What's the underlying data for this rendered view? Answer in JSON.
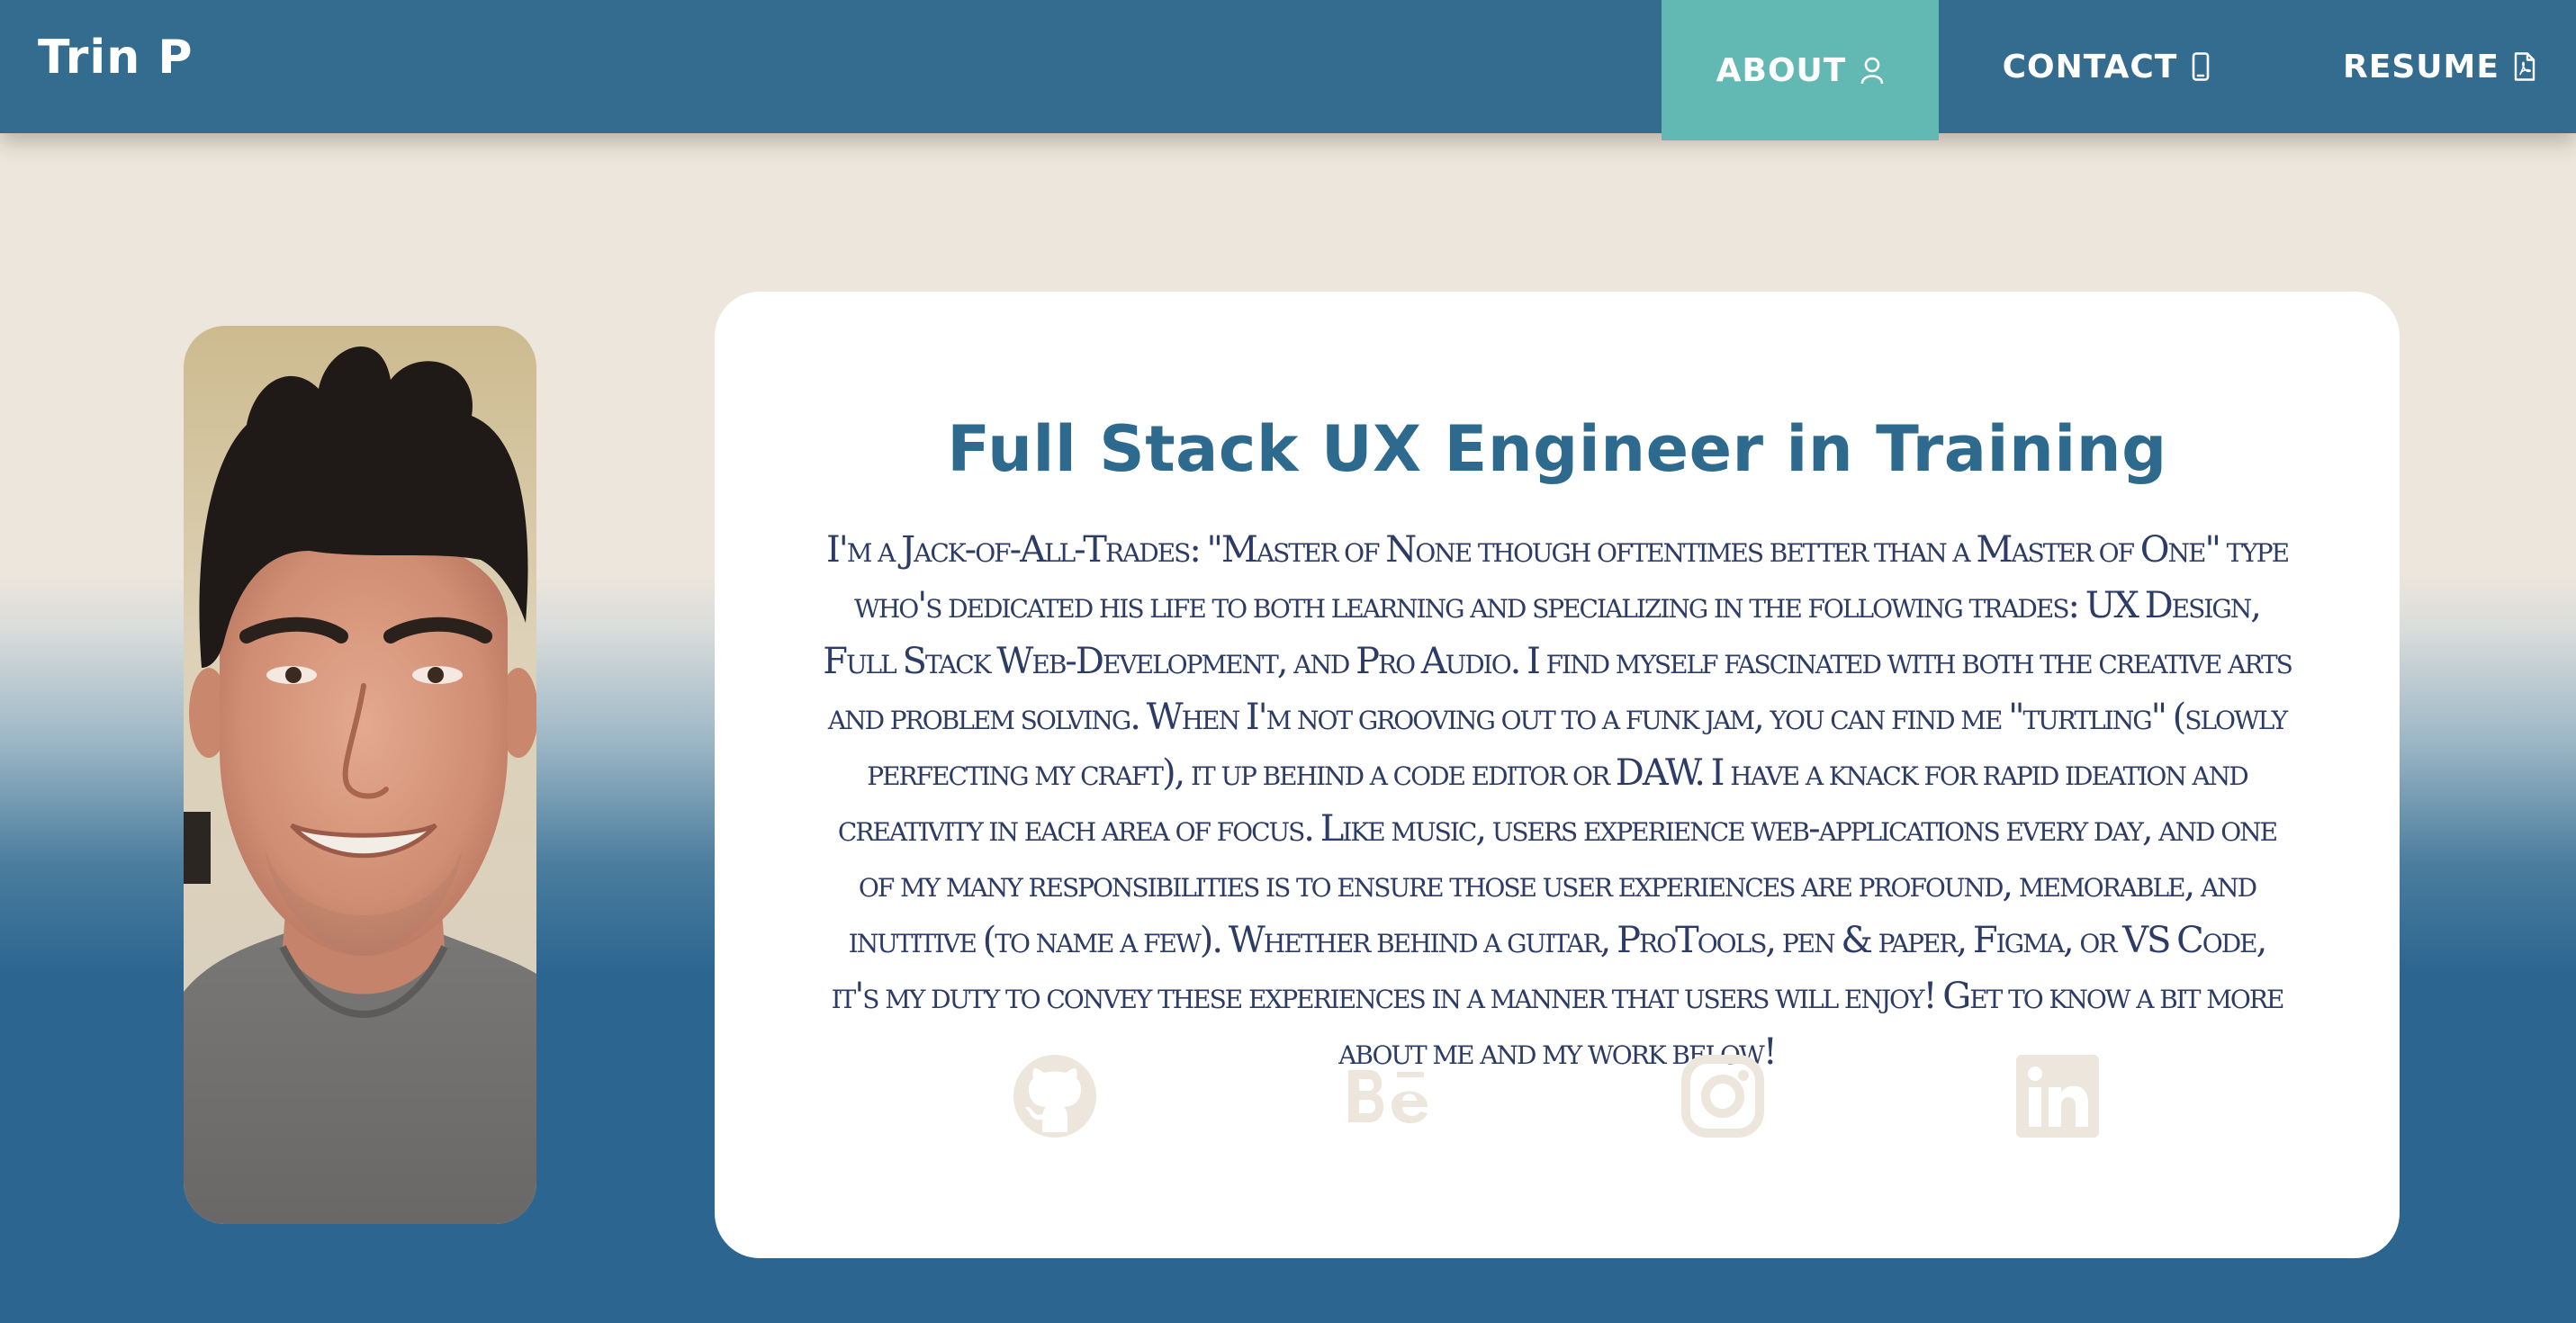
{
  "header": {
    "brand": "Trin P",
    "nav": [
      {
        "label": "ABOUT",
        "icon": "user-icon",
        "active": true
      },
      {
        "label": "CONTACT",
        "icon": "phone-icon",
        "active": false
      },
      {
        "label": "RESUME",
        "icon": "pdf-file-icon",
        "active": false
      }
    ]
  },
  "photo": {
    "alt": "Portrait of Trin P"
  },
  "card": {
    "title": "Full Stack UX Engineer in Training",
    "bio": "I'm a Jack-of-All-Trades: \"Master of None though oftentimes better than a Master of One\" type who's dedicated his life to both learning and specializing in the following trades: UX Design, Full Stack Web-Development, and Pro Audio. I find myself fascinated with both the creative arts and problem solving. When I'm not grooving out to a funk jam, you can find me \"turtling\" (slowly perfecting my craft), it up behind a code editor or DAW. I have a knack for rapid ideation and creativity in each area of focus. Like music, users experience web-applications every day, and one of my many responsibilities is to ensure those user experiences are profound, memorable, and inutitive (to name a few). Whether behind a guitar, ProTools, pen & paper, Figma, or VS Code, it's my duty to convey these experiences in a manner that users will enjoy! Get to know a bit more about me and my work below!"
  },
  "socials": [
    {
      "name": "github-icon"
    },
    {
      "name": "behance-icon"
    },
    {
      "name": "instagram-icon"
    },
    {
      "name": "linkedin-icon"
    }
  ],
  "colors": {
    "header": "#336c8f",
    "active_tab": "#62b9b4",
    "title": "#2d6a8e",
    "body_text": "#2d3c66",
    "social_icons": "#ece6dc",
    "page_top": "#ece6dc",
    "page_bottom": "#2c6690"
  }
}
